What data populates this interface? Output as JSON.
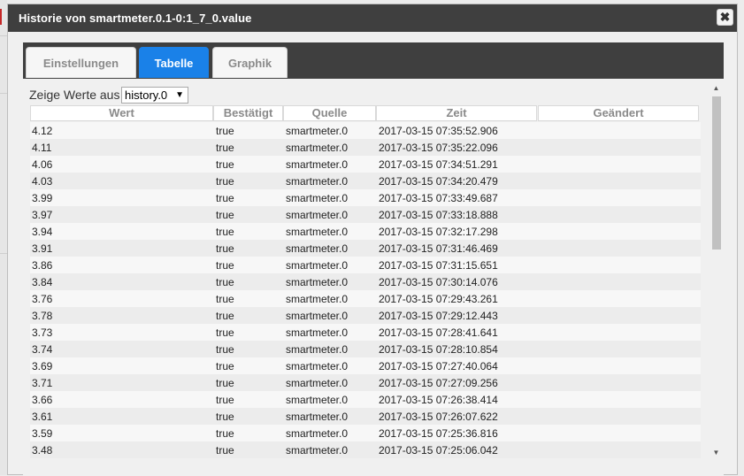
{
  "dialog": {
    "title": "Historie von smartmeter.0.1-0:1_7_0.value",
    "close_label": "✖"
  },
  "tabs": [
    {
      "label": "Einstellungen",
      "active": false
    },
    {
      "label": "Tabelle",
      "active": true
    },
    {
      "label": "Graphik",
      "active": false
    }
  ],
  "filter": {
    "label": "Zeige Werte aus",
    "selected": "history.0"
  },
  "table": {
    "columns": [
      "Wert",
      "Bestätigt",
      "Quelle",
      "Zeit",
      "Geändert"
    ],
    "rows": [
      {
        "wert": "4.12",
        "bestaetigt": "true",
        "quelle": "smartmeter.0",
        "zeit": "2017-03-15 07:35:52.906",
        "geaendert": ""
      },
      {
        "wert": "4.11",
        "bestaetigt": "true",
        "quelle": "smartmeter.0",
        "zeit": "2017-03-15 07:35:22.096",
        "geaendert": ""
      },
      {
        "wert": "4.06",
        "bestaetigt": "true",
        "quelle": "smartmeter.0",
        "zeit": "2017-03-15 07:34:51.291",
        "geaendert": ""
      },
      {
        "wert": "4.03",
        "bestaetigt": "true",
        "quelle": "smartmeter.0",
        "zeit": "2017-03-15 07:34:20.479",
        "geaendert": ""
      },
      {
        "wert": "3.99",
        "bestaetigt": "true",
        "quelle": "smartmeter.0",
        "zeit": "2017-03-15 07:33:49.687",
        "geaendert": ""
      },
      {
        "wert": "3.97",
        "bestaetigt": "true",
        "quelle": "smartmeter.0",
        "zeit": "2017-03-15 07:33:18.888",
        "geaendert": ""
      },
      {
        "wert": "3.94",
        "bestaetigt": "true",
        "quelle": "smartmeter.0",
        "zeit": "2017-03-15 07:32:17.298",
        "geaendert": ""
      },
      {
        "wert": "3.91",
        "bestaetigt": "true",
        "quelle": "smartmeter.0",
        "zeit": "2017-03-15 07:31:46.469",
        "geaendert": ""
      },
      {
        "wert": "3.86",
        "bestaetigt": "true",
        "quelle": "smartmeter.0",
        "zeit": "2017-03-15 07:31:15.651",
        "geaendert": ""
      },
      {
        "wert": "3.84",
        "bestaetigt": "true",
        "quelle": "smartmeter.0",
        "zeit": "2017-03-15 07:30:14.076",
        "geaendert": ""
      },
      {
        "wert": "3.76",
        "bestaetigt": "true",
        "quelle": "smartmeter.0",
        "zeit": "2017-03-15 07:29:43.261",
        "geaendert": ""
      },
      {
        "wert": "3.78",
        "bestaetigt": "true",
        "quelle": "smartmeter.0",
        "zeit": "2017-03-15 07:29:12.443",
        "geaendert": ""
      },
      {
        "wert": "3.73",
        "bestaetigt": "true",
        "quelle": "smartmeter.0",
        "zeit": "2017-03-15 07:28:41.641",
        "geaendert": ""
      },
      {
        "wert": "3.74",
        "bestaetigt": "true",
        "quelle": "smartmeter.0",
        "zeit": "2017-03-15 07:28:10.854",
        "geaendert": ""
      },
      {
        "wert": "3.69",
        "bestaetigt": "true",
        "quelle": "smartmeter.0",
        "zeit": "2017-03-15 07:27:40.064",
        "geaendert": ""
      },
      {
        "wert": "3.71",
        "bestaetigt": "true",
        "quelle": "smartmeter.0",
        "zeit": "2017-03-15 07:27:09.256",
        "geaendert": ""
      },
      {
        "wert": "3.66",
        "bestaetigt": "true",
        "quelle": "smartmeter.0",
        "zeit": "2017-03-15 07:26:38.414",
        "geaendert": ""
      },
      {
        "wert": "3.61",
        "bestaetigt": "true",
        "quelle": "smartmeter.0",
        "zeit": "2017-03-15 07:26:07.622",
        "geaendert": ""
      },
      {
        "wert": "3.59",
        "bestaetigt": "true",
        "quelle": "smartmeter.0",
        "zeit": "2017-03-15 07:25:36.816",
        "geaendert": ""
      },
      {
        "wert": "3.48",
        "bestaetigt": "true",
        "quelle": "smartmeter.0",
        "zeit": "2017-03-15 07:25:06.042",
        "geaendert": ""
      }
    ]
  },
  "scrollbar": {
    "up_icon": "scroll-up-arrow-icon",
    "down_icon": "scroll-down-arrow-icon"
  },
  "colors": {
    "titlebar": "#3f3f3f",
    "active_tab": "#1a81e8",
    "tab_strip": "#3f3f3f"
  }
}
